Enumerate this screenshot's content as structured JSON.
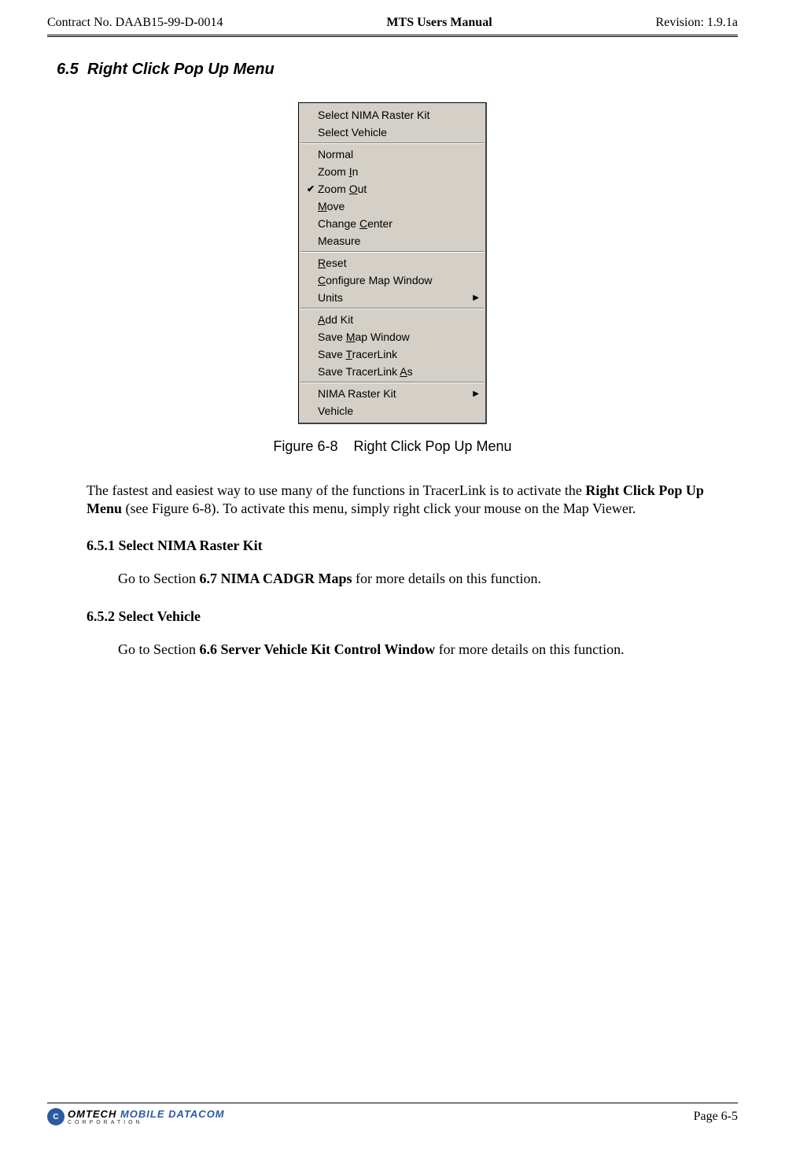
{
  "header": {
    "contract": "Contract No. DAAB15-99-D-0014",
    "title": "MTS Users Manual",
    "revision": "Revision:  1.9.1a"
  },
  "section": {
    "number": "6.5",
    "title": "Right Click Pop Up Menu"
  },
  "menu": {
    "groups": [
      {
        "items": [
          {
            "label": "Select NIMA Raster Kit",
            "checked": false,
            "submenu": false,
            "underline": null
          },
          {
            "label": "Select Vehicle",
            "checked": false,
            "submenu": false,
            "underline": null
          }
        ]
      },
      {
        "items": [
          {
            "label": "Normal",
            "checked": false,
            "submenu": false,
            "underline": null
          },
          {
            "label": "Zoom In",
            "checked": false,
            "submenu": false,
            "underline": "I",
            "pre": "Zoom ",
            "post": "n"
          },
          {
            "label": "Zoom Out",
            "checked": true,
            "submenu": false,
            "underline": "O",
            "pre": "Zoom ",
            "post": "ut"
          },
          {
            "label": "Move",
            "checked": false,
            "submenu": false,
            "underline": "M",
            "pre": "",
            "post": "ove"
          },
          {
            "label": "Change Center",
            "checked": false,
            "submenu": false,
            "underline": "C",
            "pre": "Change ",
            "post": "enter"
          },
          {
            "label": "Measure",
            "checked": false,
            "submenu": false,
            "underline": null
          }
        ]
      },
      {
        "items": [
          {
            "label": "Reset",
            "checked": false,
            "submenu": false,
            "underline": "R",
            "pre": "",
            "post": "eset"
          },
          {
            "label": "Configure Map Window",
            "checked": false,
            "submenu": false,
            "underline": "C",
            "pre": "",
            "post": "onfigure Map Window"
          },
          {
            "label": "Units",
            "checked": false,
            "submenu": true,
            "underline": null
          }
        ]
      },
      {
        "items": [
          {
            "label": "Add Kit",
            "checked": false,
            "submenu": false,
            "underline": "A",
            "pre": "",
            "post": "dd Kit"
          },
          {
            "label": "Save Map Window",
            "checked": false,
            "submenu": false,
            "underline": "M",
            "pre": "Save ",
            "post": "ap Window"
          },
          {
            "label": "Save TracerLink",
            "checked": false,
            "submenu": false,
            "underline": "T",
            "pre": "Save ",
            "post": "racerLink"
          },
          {
            "label": "Save TracerLink As",
            "checked": false,
            "submenu": false,
            "underline": "A",
            "pre": "Save TracerLink ",
            "post": "s"
          }
        ]
      },
      {
        "items": [
          {
            "label": "NIMA Raster Kit",
            "checked": false,
            "submenu": true,
            "underline": null
          },
          {
            "label": "Vehicle",
            "checked": false,
            "submenu": false,
            "underline": null
          }
        ]
      }
    ]
  },
  "figure": {
    "number": "Figure 6-8",
    "caption": "Right Click Pop Up Menu"
  },
  "paragraphs": {
    "intro_pre": "The fastest and easiest way to use many of the functions in TracerLink is to activate the ",
    "intro_bold": "Right Click Pop Up Menu",
    "intro_post": " (see Figure 6-8). To activate this menu, simply right click your mouse on the Map Viewer."
  },
  "sub1": {
    "heading": "6.5.1  Select NIMA Raster Kit",
    "pre": "Go to Section ",
    "bold": "6.7 NIMA CADGR Maps",
    "post": " for more details on this function."
  },
  "sub2": {
    "heading": "6.5.2  Select Vehicle",
    "pre": "Go to Section ",
    "bold": "6.6 Server Vehicle Kit Control Window",
    "post": " for more details on this function."
  },
  "footer": {
    "logo_omtech": "OMTECH",
    "logo_mobile": "MOBILE DATACOM",
    "logo_corp": "CORPORATION",
    "page": "Page 6-5"
  }
}
